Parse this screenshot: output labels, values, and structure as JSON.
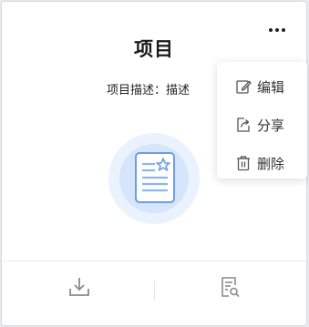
{
  "card": {
    "title": "项目",
    "description": "项目描述：描述"
  },
  "more_menu": {
    "items": [
      {
        "label": "编辑",
        "icon": "edit-icon"
      },
      {
        "label": "分享",
        "icon": "share-icon"
      },
      {
        "label": "删除",
        "icon": "delete-icon"
      }
    ]
  },
  "footer": {
    "download_icon": "download-icon",
    "preview_icon": "document-search-icon"
  },
  "colors": {
    "illustration_light": "#e6f0fd",
    "illustration_mid": "#cfe1fb",
    "illustration_accent": "#6f9ce8",
    "icon_gray": "#8a8a8a"
  }
}
